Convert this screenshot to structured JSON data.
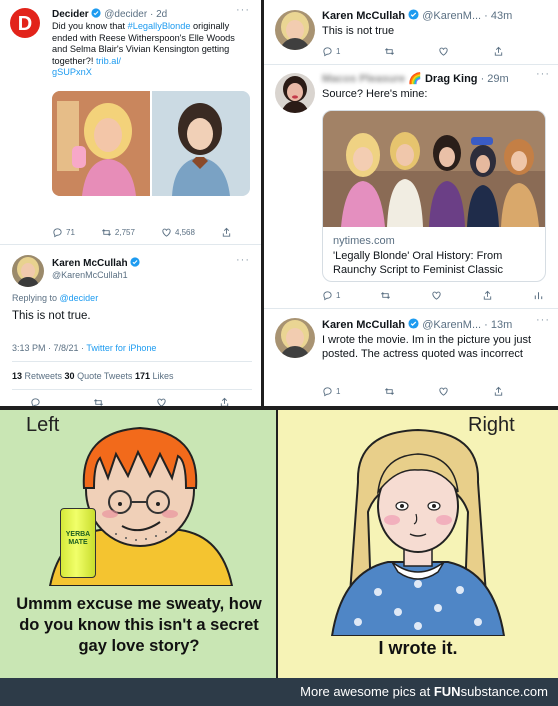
{
  "left_tweet": {
    "author": "Decider",
    "handle_time": "@decider · 2d",
    "text_pre": "Did you know that ",
    "hashtag": "#LegallyBlonde",
    "text_post": " originally ended with Reese Witherspoon's Elle Woods and Selma Blair's Vivian Kensington getting together?! ",
    "link1": "trib.al/",
    "link2": "gSUPxnX",
    "stats": {
      "replies": "71",
      "retweets": "2,757",
      "likes": "4,568"
    }
  },
  "left_reply": {
    "author": "Karen McCullah",
    "handle": "@KarenMcCullah1",
    "replying_to_label": "Replying to ",
    "replying_to": "@decider",
    "text": "This is not true.",
    "meta_date": "3:13 PM · 7/8/21 · ",
    "meta_client": "Twitter for iPhone",
    "retweets_count": "13",
    "retweets_label": " Retweets ",
    "quotes_count": "30",
    "quotes_label": " Quote Tweets ",
    "likes_count": "171",
    "likes_label": " Likes"
  },
  "right_thread": {
    "tweet1": {
      "author": "Karen McCullah",
      "handle_time": "@KarenM... · 43m",
      "text": "This is not true",
      "replies": "1"
    },
    "tweet2": {
      "author_blurred": "Macos Pleasure",
      "author_tag": "🌈 Drag King",
      "time": " · 29m",
      "text": "Source? Here's mine:",
      "card_domain": "nytimes.com",
      "card_title": "'Legally Blonde' Oral History: From Raunchy Script to Feminist Classic",
      "replies": "1"
    },
    "tweet3": {
      "author": "Karen McCullah",
      "handle_time": "@KarenM... · 13m",
      "text": "I wrote the movie. Im in the picture you just posted. The actress quoted was incorrect",
      "replies": "1"
    }
  },
  "meme": {
    "left_label": "Left",
    "left_caption": "Ummm excuse me sweaty, how do you know this isn't a secret gay love story?",
    "can_brand": "YERBA MATE",
    "right_label": "Right",
    "right_caption": "I wrote it."
  },
  "footer": {
    "text": "More awesome pics at",
    "brand_fun": "FUN",
    "brand_rest": "substance.com"
  },
  "colors": {
    "twitter_blue": "#1d9bf0",
    "decider_red": "#e2231a",
    "left_bg": "#c9e6b4",
    "right_bg": "#f6f3b6",
    "footer_bg": "#2d3b48"
  }
}
